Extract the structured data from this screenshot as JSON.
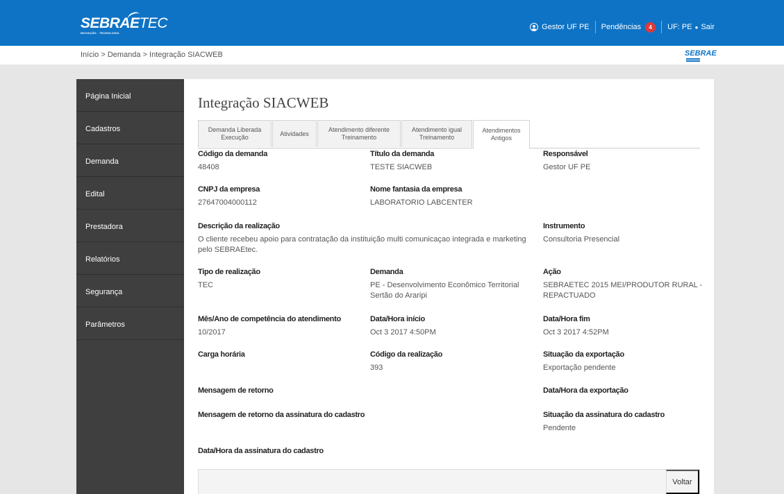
{
  "header": {
    "logo_main": "SEBRAE",
    "logo_tec": "TEC",
    "logo_tagline": "INOVAÇÃO - TECNOLOGIA",
    "user_label": "Gestor UF PE",
    "pendencias_label": "Pendências",
    "pendencias_count": "4",
    "uf_label": "UF: PE",
    "dot": "●",
    "logout_label": "Sair",
    "accent_color": "#0e73c5"
  },
  "breadcrumb": {
    "text": "Início > Demanda > Integração SIACWEB",
    "brand_logo": "SEBRAE"
  },
  "sidebar": {
    "items": [
      {
        "label": "Página Inicial"
      },
      {
        "label": "Cadastros"
      },
      {
        "label": "Demanda"
      },
      {
        "label": "Edital"
      },
      {
        "label": "Prestadora"
      },
      {
        "label": "Relatórios"
      },
      {
        "label": "Segurança"
      },
      {
        "label": "Parâmetros"
      }
    ]
  },
  "page": {
    "title": "Integração SIACWEB",
    "tabs": [
      {
        "label_line1": "Demanda Liberada",
        "label_line2": "Execução"
      },
      {
        "label_line1": "Atividades",
        "label_line2": ""
      },
      {
        "label_line1": "Atendimento diferente",
        "label_line2": "Treinamento"
      },
      {
        "label_line1": "Atendimento igual",
        "label_line2": "Treinamento"
      },
      {
        "label_line1": "Atendimentos",
        "label_line2": "Antigos"
      }
    ],
    "active_tab": "Atendimentos Antigos"
  },
  "fields": {
    "codigo_demanda": {
      "label": "Código da demanda",
      "value": "48408"
    },
    "titulo_demanda": {
      "label": "Título da demanda",
      "value": "TESTE SIACWEB"
    },
    "responsavel": {
      "label": "Responsável",
      "value": "Gestor UF PE"
    },
    "cnpj": {
      "label": "CNPJ da empresa",
      "value": "27647004000112"
    },
    "nome_fantasia": {
      "label": "Nome fantasia da empresa",
      "value": "LABORATORIO LABCENTER"
    },
    "descricao": {
      "label": "Descrição da realização",
      "value": "O cliente recebeu apoio para contratação da instituição multi comunicaçao integrada e marketing pelo SEBRAEtec."
    },
    "instrumento": {
      "label": "Instrumento",
      "value": "Consultoria Presencial"
    },
    "tipo_realizacao": {
      "label": "Tipo de realização",
      "value": "TEC"
    },
    "demanda": {
      "label": "Demanda",
      "value": "PE - Desenvolvimento Econômico Territorial Sertão do Araripi"
    },
    "acao": {
      "label": "Ação",
      "value": "SEBRAETEC 2015 MEI/PRODUTOR RURAL - REPACTUADO"
    },
    "mes_ano": {
      "label": "Mês/Ano de competência do atendimento",
      "value": "10/2017"
    },
    "data_inicio": {
      "label": "Data/Hora início",
      "value": "Oct 3 2017 4:50PM"
    },
    "data_fim": {
      "label": "Data/Hora fim",
      "value": "Oct 3 2017 4:52PM"
    },
    "carga_horaria": {
      "label": "Carga horária",
      "value": ""
    },
    "codigo_realizacao": {
      "label": "Código da realização",
      "value": "393"
    },
    "situacao_exportacao": {
      "label": "Situação da exportação",
      "value": "Exportação pendente"
    },
    "mensagem_retorno": {
      "label": "Mensagem de retorno",
      "value": ""
    },
    "data_exportacao": {
      "label": "Data/Hora da exportação",
      "value": ""
    },
    "mensagem_assinatura": {
      "label": "Mensagem de retorno da assinatura do cadastro",
      "value": ""
    },
    "situacao_assinatura": {
      "label": "Situação da assinatura do cadastro",
      "value": "Pendente"
    },
    "data_assinatura": {
      "label": "Data/Hora da assinatura do cadastro",
      "value": ""
    }
  },
  "footer": {
    "back_button": "Voltar"
  }
}
